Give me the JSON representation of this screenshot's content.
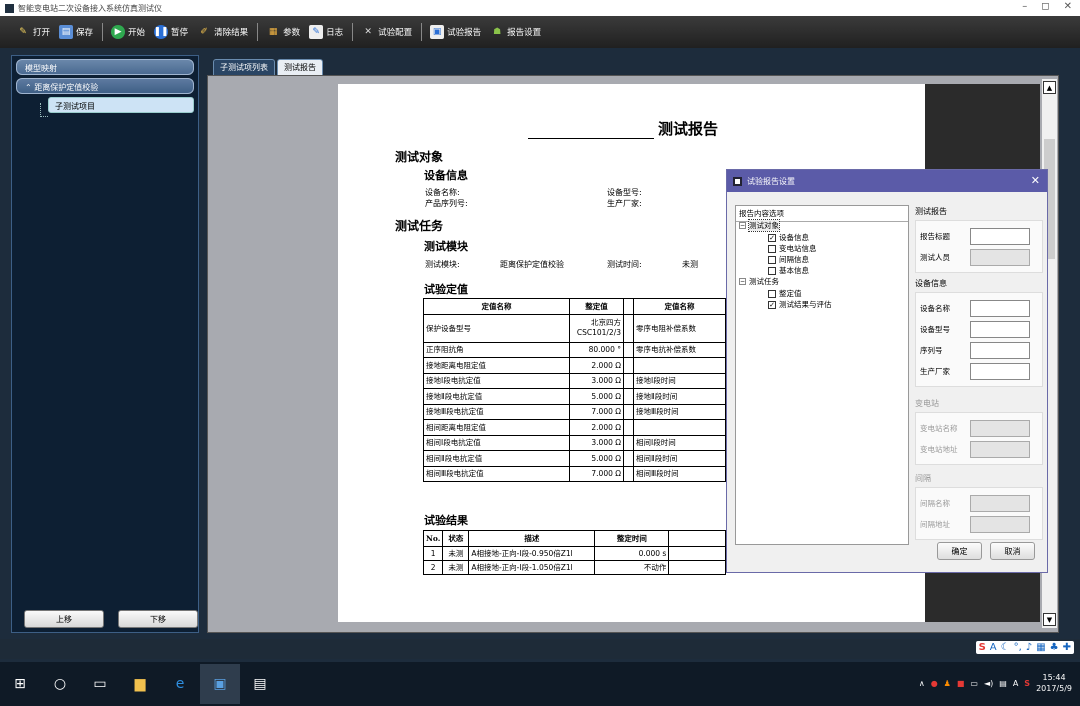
{
  "window": {
    "title": "智能变电站二次设备接入系统仿真测试仪",
    "minimize": "–",
    "restore": "◻",
    "close": "✕"
  },
  "toolbar": {
    "open": "打开",
    "save": "保存",
    "start": "开始",
    "pause": "暂停",
    "clear": "清除结果",
    "params": "参数",
    "log": "日志",
    "test_config": "试验配置",
    "test_report": "试验报告",
    "report_settings": "报告设置"
  },
  "sidebar": {
    "model_mapping": "模型映射",
    "group": "距离保护定值校验",
    "item": "子测试项目",
    "move_up": "上移",
    "move_down": "下移"
  },
  "tabs": [
    "子测试项列表",
    "测试报告"
  ],
  "report": {
    "title_suffix": "测试报告",
    "test_object": "测试对象",
    "device_info": "设备信息",
    "device_name": "设备名称:",
    "device_model": "设备型号:",
    "serial_no": "产品序列号:",
    "manufacturer": "生产厂家:",
    "test_task": "测试任务",
    "test_module": "测试模块",
    "module_label": "测试模块:",
    "module_value": "距离保护定值校验",
    "time_label": "测试时间:",
    "time_value": "未测",
    "settings_title": "试验定值",
    "settings_headers": [
      "定值名称",
      "整定值",
      "定值名称"
    ],
    "settings_rows": [
      {
        "name": "保护设备型号",
        "value": "北京四方 CSC101/2/3",
        "name2": "零序电阻补偿系数"
      },
      {
        "name": "正序阻抗角",
        "value": "80.000 °",
        "name2": "零序电抗补偿系数"
      },
      {
        "name": "接地距离电阻定值",
        "value": "2.000 Ω",
        "name2": ""
      },
      {
        "name": "接地Ⅰ段电抗定值",
        "value": "3.000 Ω",
        "name2": "接地Ⅰ段时间"
      },
      {
        "name": "接地Ⅱ段电抗定值",
        "value": "5.000 Ω",
        "name2": "接地Ⅱ段时间"
      },
      {
        "name": "接地Ⅲ段电抗定值",
        "value": "7.000 Ω",
        "name2": "接地Ⅲ段时间"
      },
      {
        "name": "相间距离电阻定值",
        "value": "2.000 Ω",
        "name2": ""
      },
      {
        "name": "相间Ⅰ段电抗定值",
        "value": "3.000 Ω",
        "name2": "相间Ⅰ段时间"
      },
      {
        "name": "相间Ⅱ段电抗定值",
        "value": "5.000 Ω",
        "name2": "相间Ⅱ段时间"
      },
      {
        "name": "相间Ⅲ段电抗定值",
        "value": "7.000 Ω",
        "name2": "相间Ⅲ段时间"
      }
    ],
    "results_title": "试验结果",
    "results_headers": [
      "No.",
      "状态",
      "描述",
      "整定时间"
    ],
    "results_rows": [
      {
        "no": "1",
        "status": "未测",
        "desc": "A相接地-正向-Ⅰ段-0.950倍Z1l",
        "time": "0.000 s"
      },
      {
        "no": "2",
        "status": "未测",
        "desc": "A相接地-正向-Ⅰ段-1.050倍Z1l",
        "time": "不动作"
      }
    ]
  },
  "dialog": {
    "title": "试验报告设置",
    "tree_header": "报告内容选项",
    "tree": {
      "test_object": "测试对象",
      "device_info": "设备信息",
      "substation_info": "变电站信息",
      "bay_info": "间隔信息",
      "basic_info": "基本信息",
      "test_task": "测试任务",
      "settings": "整定值",
      "results_eval": "测试结果与评估"
    },
    "checked": {
      "device_info": true,
      "substation_info": false,
      "bay_info": false,
      "basic_info": false,
      "settings": false,
      "results_eval": true
    },
    "report_group": "测试报告",
    "report_title": "报告标题",
    "tester": "测试人员",
    "device_group": "设备信息",
    "device_name": "设备名称",
    "device_model": "设备型号",
    "serial": "序列号",
    "manufacturer": "生产厂家",
    "substation_group": "变电站",
    "substation_name": "变电站名称",
    "substation_address": "变电站地址",
    "bay_group": "间隔",
    "bay_name": "间隔名称",
    "bay_address": "间隔地址",
    "ok": "确定",
    "cancel": "取消"
  },
  "taskbar": {
    "time": "15:44",
    "date": "2017/5/9",
    "ime_lang": "A"
  }
}
